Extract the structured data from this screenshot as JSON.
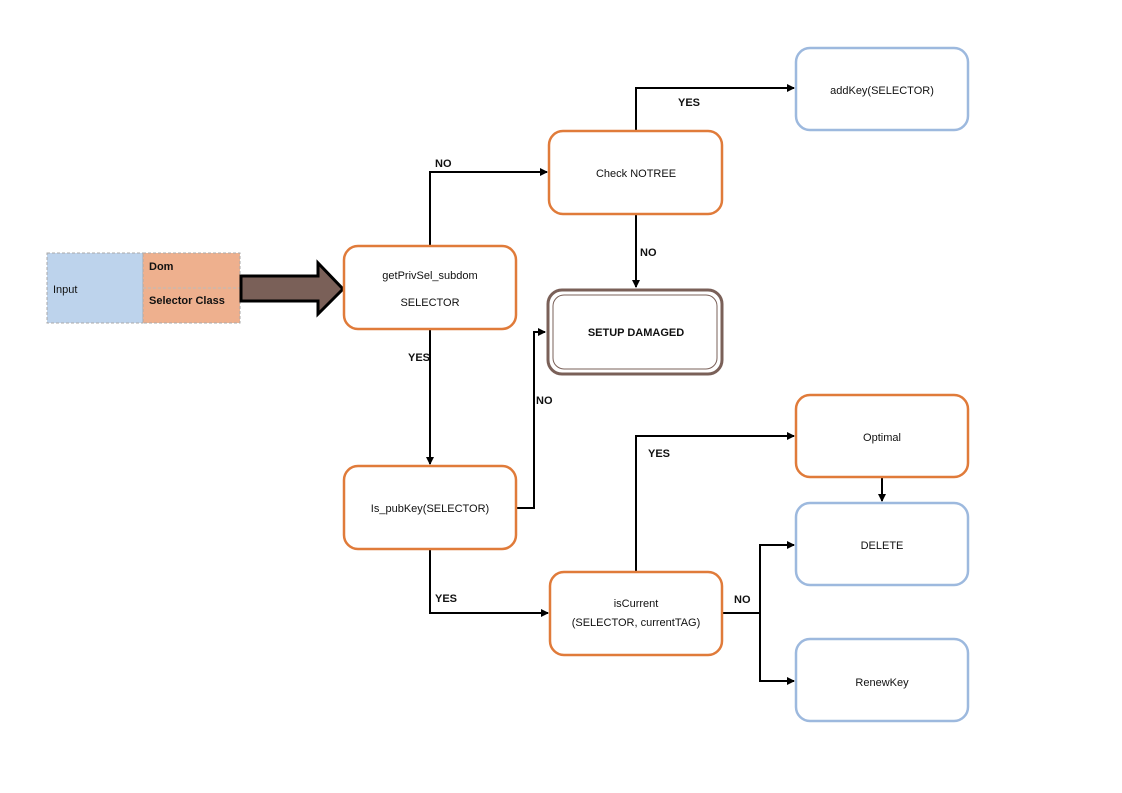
{
  "colors": {
    "process": "#E07B3A",
    "terminal": "#9DB9DE",
    "error": "#7A6058",
    "input_left": "#BDD3EC",
    "input_right": "#EEB08E"
  },
  "input": {
    "label": "Input",
    "fields": [
      "Dom",
      "Selector Class"
    ]
  },
  "nodes": {
    "getpriv": {
      "line1": "getPrivSel_subdom",
      "line2": "SELECTOR"
    },
    "check_notree": "Check NOTREE",
    "addkey": "addKey(SELECTOR)",
    "setup_damaged": "SETUP DAMAGED",
    "is_pubkey": "Is_pubKey(SELECTOR)",
    "iscurrent": {
      "line1": "isCurrent",
      "line2": "(SELECTOR, currentTAG)"
    },
    "optimal": "Optimal",
    "delete": "DELETE",
    "renewkey": "RenewKey"
  },
  "edges": {
    "getpriv_no": "NO",
    "notree_yes": "YES",
    "notree_no": "NO",
    "getpriv_yes": "YES",
    "pubkey_no": "NO",
    "pubkey_yes": "YES",
    "current_yes": "YES",
    "current_no": "NO"
  }
}
